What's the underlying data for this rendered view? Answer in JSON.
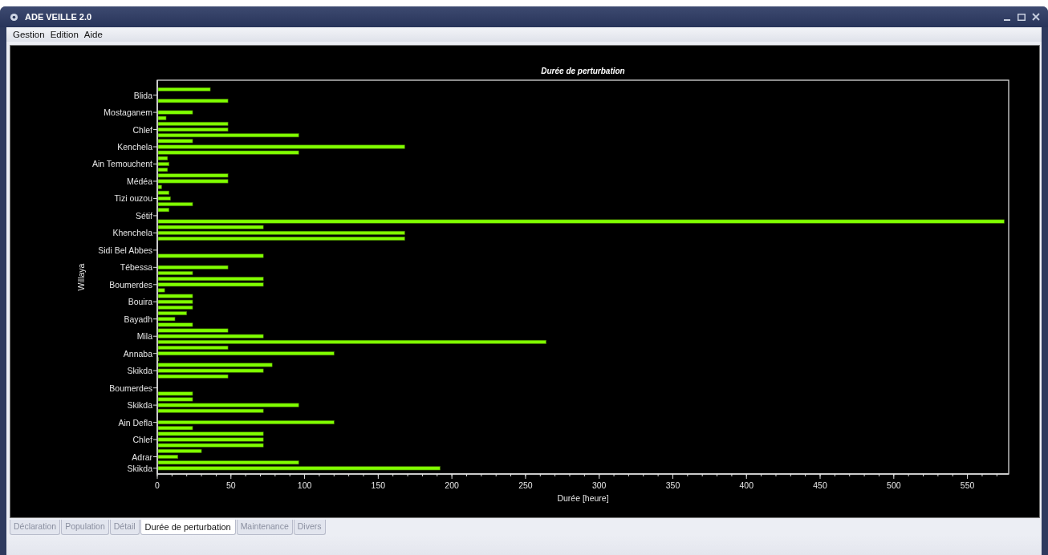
{
  "window": {
    "title": "ADE VEILLE 2.0"
  },
  "menu": [
    "Gestion",
    "Edition",
    "Aide"
  ],
  "chart": {
    "chart_data": {
      "type": "bar",
      "orientation": "horizontal",
      "title": "Durée de perturbation",
      "xlabel": "Durée [heure]",
      "ylabel": "Willaya",
      "categories": [
        "Blida",
        "Mostaganem",
        "Chlef",
        "Kenchela",
        "Ain Temouchent",
        "Médéa",
        "Tizi ouzou",
        "Sétif",
        "Khenchela",
        "Sidi Bel Abbes",
        "Tébessa",
        "Boumerdes",
        "Bouira",
        "Bayadh",
        "Mila",
        "Annaba",
        "Skikda",
        "Boumerdes",
        "Skikda",
        "Ain Defla",
        "Chlef",
        "Adrar",
        "Skikda"
      ],
      "series": [
        {
          "color": "#80ff00",
          "values": [
            36,
            0,
            48,
            24,
            7,
            48,
            8,
            8,
            72,
            0,
            0,
            72,
            24,
            20,
            48,
            48,
            78,
            0,
            24,
            0,
            72,
            30,
            192
          ]
        },
        {
          "color": "#80ff00",
          "values": [
            0,
            24,
            48,
            168,
            8,
            48,
            9,
            0,
            168,
            0,
            48,
            72,
            24,
            12,
            72,
            120,
            72,
            0,
            96,
            120,
            72,
            14,
            null
          ]
        },
        {
          "color": "#80ff00",
          "values": [
            48,
            6,
            96,
            96,
            7,
            3,
            24,
            575,
            168,
            72,
            24,
            5,
            24,
            24,
            264,
            1,
            48,
            24,
            72,
            24,
            72,
            96,
            null
          ]
        }
      ],
      "xlim": [
        0,
        578
      ],
      "xticks": [
        0,
        50,
        100,
        150,
        200,
        250,
        300,
        350,
        400,
        450,
        500,
        550
      ]
    }
  },
  "tabs": [
    {
      "label": "Déclaration",
      "selected": false
    },
    {
      "label": "Population",
      "selected": false
    },
    {
      "label": "Détail",
      "selected": false
    },
    {
      "label": "Durée de perturbation",
      "selected": true
    },
    {
      "label": "Maintenance",
      "selected": false
    },
    {
      "label": "Divers",
      "selected": false
    }
  ]
}
